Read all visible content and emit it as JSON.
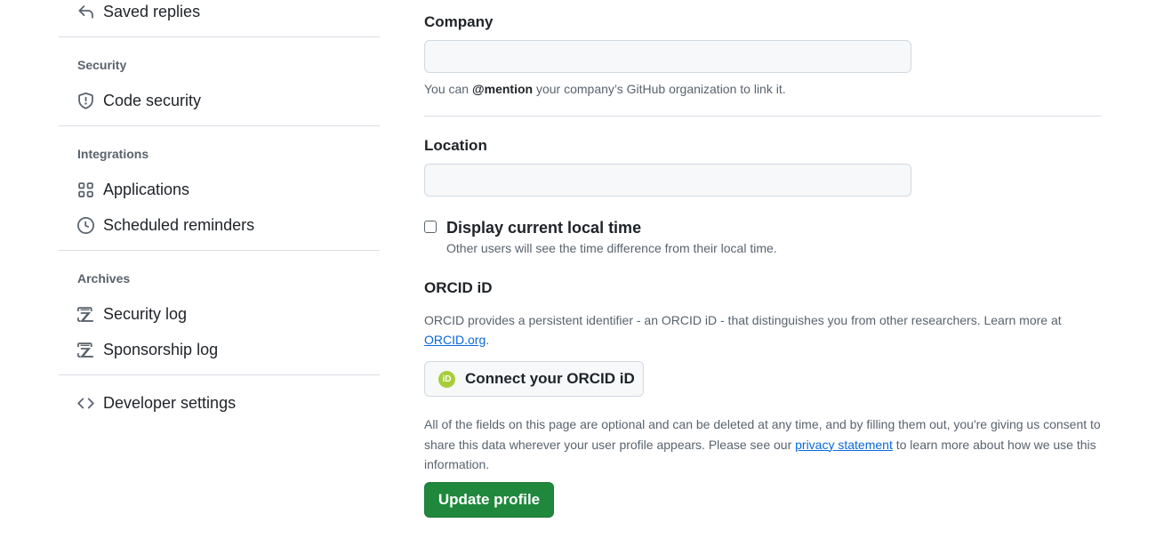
{
  "sidebar": {
    "saved_replies": {
      "label": "Saved replies",
      "icon": "reply-icon"
    },
    "sections": {
      "security": {
        "title": "Security",
        "items": [
          {
            "label": "Code security",
            "icon": "shield-icon"
          }
        ]
      },
      "integrations": {
        "title": "Integrations",
        "items": [
          {
            "label": "Applications",
            "icon": "apps-grid-icon"
          },
          {
            "label": "Scheduled reminders",
            "icon": "clock-icon"
          }
        ]
      },
      "archives": {
        "title": "Archives",
        "items": [
          {
            "label": "Security log",
            "icon": "log-icon"
          },
          {
            "label": "Sponsorship log",
            "icon": "log-icon"
          }
        ]
      }
    },
    "developer_settings": {
      "label": "Developer settings",
      "icon": "code-icon"
    }
  },
  "main": {
    "company": {
      "label": "Company",
      "value": "",
      "note_prefix": "You can ",
      "note_mention": "@mention",
      "note_suffix": " your company’s GitHub organization to link it."
    },
    "location": {
      "label": "Location",
      "value": ""
    },
    "local_time": {
      "label": "Display current local time",
      "note": "Other users will see the time difference from their local time.",
      "checked": false
    },
    "orcid": {
      "title": "ORCID iD",
      "description": "ORCID provides a persistent identifier - an ORCID iD - that distinguishes you from other researchers. Learn more at ",
      "link_text": "ORCID.org",
      "after_link": ".",
      "button_label": "Connect your ORCID iD",
      "badge_text": "iD"
    },
    "disclaimer": {
      "before_link": "All of the fields on this page are optional and can be deleted at any time, and by filling them out, you're giving us consent to share this data wherever your user profile appears. Please see our ",
      "link_text": "privacy statement",
      "after_link": " to learn more about how we use this information."
    },
    "update_button": "Update profile"
  },
  "colors": {
    "primary_button": "#1f883d",
    "link": "#0969da",
    "orcid_green": "#a6ce39",
    "muted_text": "#59636e",
    "border": "#d1d9e0"
  }
}
